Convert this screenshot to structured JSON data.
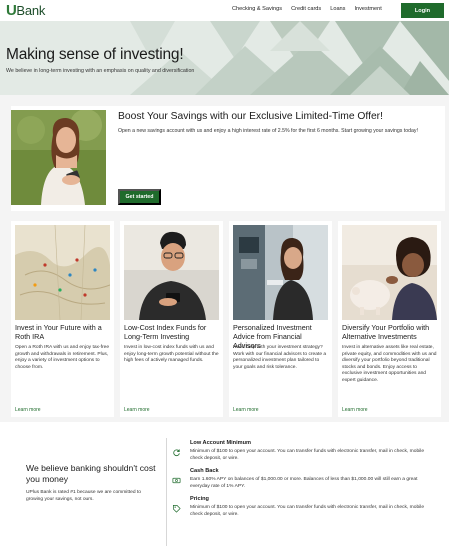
{
  "brand": {
    "logo_u": "U",
    "logo_bank": "Bank",
    "accent": "#1f6b2c"
  },
  "nav": {
    "links": [
      "Checking & Savings",
      "Credit cards",
      "Loans",
      "Investment"
    ],
    "login_label": "Login"
  },
  "hero": {
    "title": "Making sense of investing!",
    "subtitle": "We believe in long-term investing with an emphasis on quality and diversification"
  },
  "promo": {
    "title": "Boost Your Savings with our Exclusive Limited-Time Offer!",
    "text": "Open a new savings account with us and enjoy a high interest rate of 2.5% for the first 6 months. Start growing your savings today!",
    "button_label": "Get started"
  },
  "cards": [
    {
      "title": "Invest in Your Future with a Roth IRA",
      "text": "Open a Roth IRA with us and enjoy tax-free growth and withdrawals in retirement. Plus, enjoy a variety of investment options to choose from.",
      "link": "Learn more"
    },
    {
      "title": "Low-Cost Index Funds for Long-Term Investing",
      "text": "Invest in low-cost index funds with us and enjoy long-term growth potential without the high fees of actively managed funds.",
      "link": "Learn more"
    },
    {
      "title": "Personalized Investment Advice from Financial Advisors",
      "text": "Need help with your investment strategy? Work with our financial advisors to create a personalized investment plan tailored to your goals and risk tolerance.",
      "link": "Learn more"
    },
    {
      "title": "Diversify Your Portfolio with Alternative Investments",
      "text": "Invest in alternative assets like real estate, private equity, and commodities with us and diversify your portfolio beyond traditional stocks and bonds. Enjoy access to exclusive investment opportunities and expert guidance.",
      "link": "Learn more"
    }
  ],
  "bottom": {
    "heading": "We believe banking shouldn't cost you money",
    "text": "UPlus Bank is rated #1 because we are committed to growing your savings, not ours.",
    "features": [
      {
        "icon": "refresh-icon",
        "title": "Low Account Minimum",
        "text": "Minimum of $100 to open your account. You can transfer funds with electronic transfer, mail in check, mobile check deposit, or wire."
      },
      {
        "icon": "cash-icon",
        "title": "Cash Back",
        "text": "Earn 1.60% APY on balances of $1,000.00 or more. Balances of less than $1,000.00 will still earn a great everyday rate of 1% APY."
      },
      {
        "icon": "tag-icon",
        "title": "Pricing",
        "text": "Minimum of $100 to open your account. You can transfer funds with electronic transfer, mail in check, mobile check deposit, or wire."
      }
    ]
  }
}
